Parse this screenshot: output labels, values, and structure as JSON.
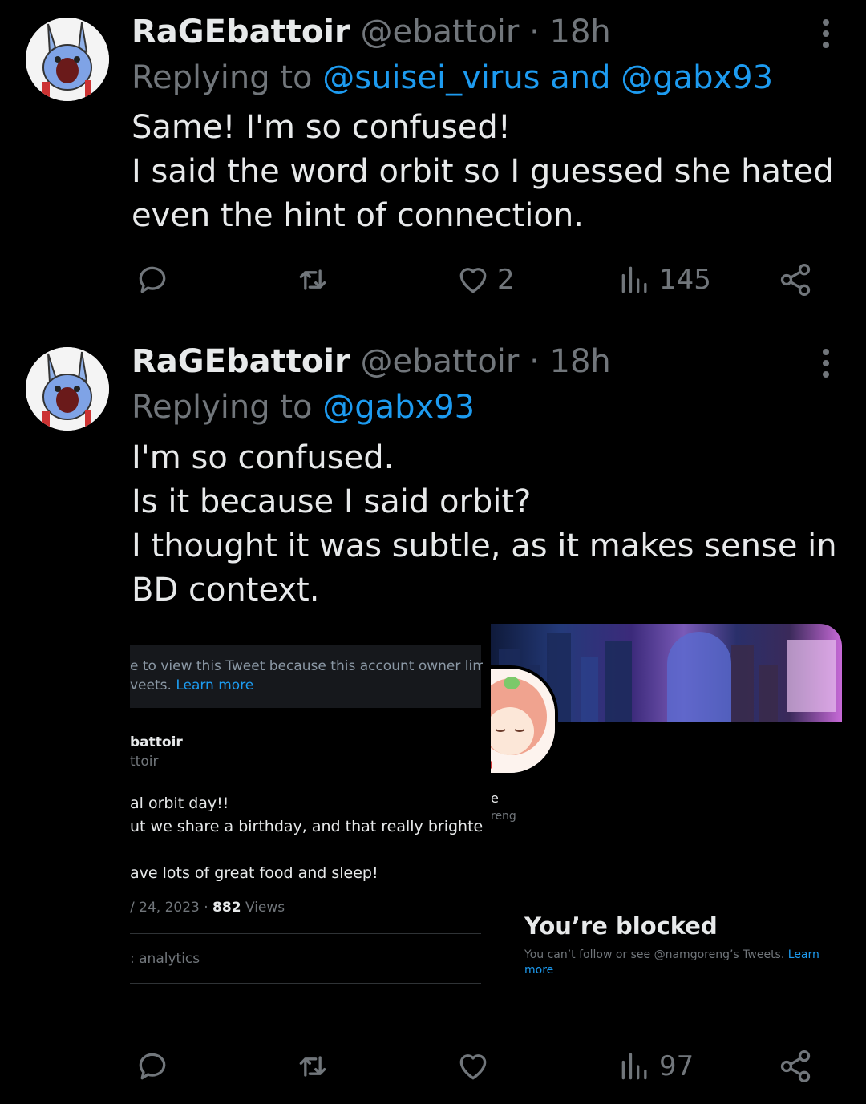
{
  "tweets": [
    {
      "display_name": "RaGEbattoir",
      "handle": "@ebattoir",
      "time": " · 18h",
      "reply_prefix": "Replying to ",
      "reply_mentions": "@suisei_virus and @gabx93",
      "lines": [
        "Same! I'm so confused!",
        "I said the word orbit so I guessed she hated",
        "even the hint of connection."
      ],
      "likes": "2",
      "views": "145"
    },
    {
      "display_name": "RaGEbattoir",
      "handle": "@ebattoir",
      "time": " · 18h",
      "reply_prefix": "Replying to ",
      "reply_mentions": "@gabx93",
      "lines": [
        "I'm so confused.",
        "Is it because I said orbit?",
        "I thought it was subtle, as it makes sense in",
        "BD context."
      ],
      "likes": "",
      "views": "97"
    }
  ],
  "embedded_left": {
    "notice_line1": "e to view this Tweet because this account owner limit",
    "notice_line2_prefix": "veets. ",
    "notice_link": "Learn more",
    "name": "battoir",
    "handle": "ttoir",
    "body_lines": [
      "al orbit day!!",
      "ut we share a birthday, and that really brightene",
      "",
      "ave lots of great food and sleep!"
    ],
    "date": "/ 24, 2023 · ",
    "views_count": "882",
    "views_label": " Views",
    "analytics": ": analytics"
  },
  "embedded_right": {
    "name_fragment": "e",
    "handle_fragment": "reng",
    "blocked_title": "You’re blocked",
    "blocked_desc": "You can’t follow or see @namgoreng’s Tweets. ",
    "blocked_link1": "Learn",
    "blocked_link2": "more"
  },
  "icons": {
    "reply": "reply-icon",
    "retweet": "retweet-icon",
    "like": "heart-icon",
    "views": "views-icon",
    "share": "share-icon",
    "more": "more-dots-icon"
  },
  "colors": {
    "background": "#000000",
    "text": "#e7e9ea",
    "muted": "#71767b",
    "link": "#1d9bf0",
    "divider": "#2f3336"
  }
}
